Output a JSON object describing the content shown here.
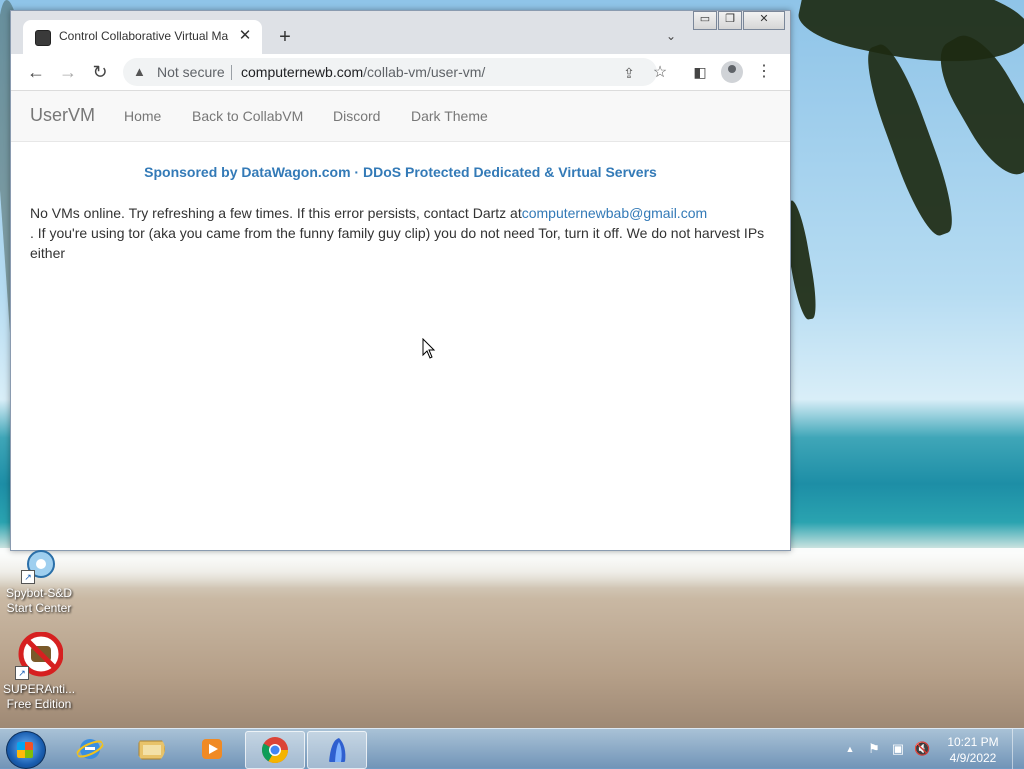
{
  "browser": {
    "tab_title": "Control Collaborative Virtual Ma",
    "tab_close_glyph": "✕",
    "new_tab_glyph": "+",
    "tab_list_glyph": "⌄",
    "window_controls": {
      "minimize": "▭",
      "maximize": "❐",
      "close": "✕"
    },
    "nav": {
      "back_glyph": "←",
      "forward_glyph": "→",
      "reload_glyph": "↻"
    },
    "address_bar": {
      "security_label": "Not secure",
      "warning_glyph": "▲",
      "url_host": "computernewb.com",
      "url_path": "/collab-vm/user-vm/"
    },
    "toolbar_glyphs": {
      "share": "⇪",
      "bookmark": "☆",
      "side_panel": "◧",
      "menu": "⋮"
    }
  },
  "page": {
    "brand": "UserVM",
    "nav_links": [
      "Home",
      "Back to CollabVM",
      "Discord",
      "Dark Theme"
    ],
    "sponsor": "Sponsored by DataWagon.com · DDoS Protected Dedicated & Virtual Servers",
    "message_before_email": "No VMs online. Try refreshing a few times. If this error persists, contact Dartz at",
    "email": "computernewbab@gmail.com",
    "message_after_email": ". If you're using tor (aka you came from the funny family guy clip) you do not need Tor, turn it off. We do not harvest IPs either"
  },
  "desktop_icons": [
    {
      "label_line1": "Spybot-S&D",
      "label_line2": "Start Center",
      "icon": "spybot-icon"
    },
    {
      "label_line1": "SUPERAnti...",
      "label_line2": "Free Edition",
      "icon": "superantispyware-icon"
    }
  ],
  "taskbar": {
    "items": [
      "internet-explorer-icon",
      "file-explorer-icon",
      "media-player-icon",
      "chrome-icon",
      "sharp-icon"
    ],
    "clock_time": "10:21 PM",
    "clock_date": "4/9/2022"
  },
  "colors": {
    "link": "#337ab7",
    "navbar_bg": "#f8f8f8"
  }
}
